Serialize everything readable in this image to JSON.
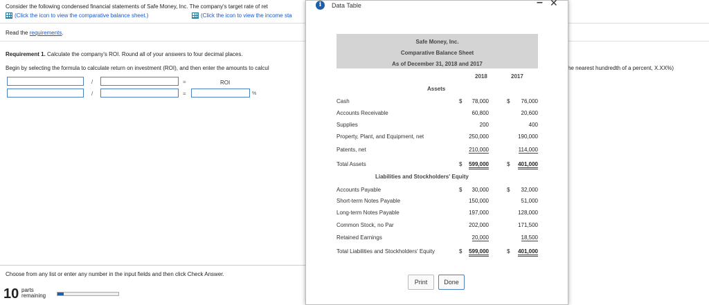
{
  "main": {
    "intro": "Consider the following condensed financial statements of Safe Money, Inc. The company's target rate of ret",
    "link_balance": "(Click the icon to view the comparative balance sheet.)",
    "link_income": "(Click the icon to view the income sta",
    "read_prefix": "Read the ",
    "read_link": "requirements",
    "read_suffix": ".",
    "req_bold": "Requirement 1.",
    "req_text": " Calculate the company's ROI. Round all of your answers to four decimal places.",
    "begin_text": "Begin by selecting the formula to calculate return on investment (ROI), and then enter the amounts to calcul",
    "right_text": "he nearest hundredth of a percent, X.XX%)",
    "slash": "/",
    "equals": "=",
    "roi_label": "ROI",
    "percent": "%",
    "footer_instruction": "Choose from any list or enter any number in the input fields and then click Check Answer.",
    "parts_count": "10",
    "parts_label": "parts",
    "remaining_label": "remaining",
    "progress_fraction": 0.1
  },
  "modal": {
    "title": "Data Table",
    "minimize": "–",
    "close": "✕",
    "company": "Safe Money, Inc.",
    "statement": "Comparative Balance Sheet",
    "date": "As of December 31, 2018 and 2017",
    "year1": "2018",
    "year2": "2017",
    "assets_header": "Assets",
    "liab_header": "Liabilities and Stockholders' Equity",
    "rows": [
      {
        "label": "Cash",
        "d1": "$",
        "v1": "78,000",
        "d2": "$",
        "v2": "76,000"
      },
      {
        "label": "Accounts Receivable",
        "v1": "60,800",
        "v2": "20,600"
      },
      {
        "label": "Supplies",
        "v1": "200",
        "v2": "400"
      },
      {
        "label": "Property, Plant, and Equipment, net",
        "v1": "250,000",
        "v2": "190,000"
      },
      {
        "label": "Patents, net",
        "v1": "210,000",
        "v2": "114,000"
      },
      {
        "label": "Total Assets",
        "d1": "$",
        "v1": "599,000",
        "d2": "$",
        "v2": "401,000"
      },
      {
        "label": "Accounts Payable",
        "d1": "$",
        "v1": "30,000",
        "d2": "$",
        "v2": "32,000"
      },
      {
        "label": "Short-term Notes Payable",
        "v1": "150,000",
        "v2": "51,000"
      },
      {
        "label": "Long-term Notes Payable",
        "v1": "197,000",
        "v2": "128,000"
      },
      {
        "label": "Common Stock, no Par",
        "v1": "202,000",
        "v2": "171,500"
      },
      {
        "label": "Retained Earnings",
        "v1": "20,000",
        "v2": "18,500"
      },
      {
        "label": "Total Liabilities and Stockholders' Equity",
        "d1": "$",
        "v1": "599,000",
        "d2": "$",
        "v2": "401,000"
      }
    ],
    "print_label": "Print",
    "done_label": "Done"
  }
}
